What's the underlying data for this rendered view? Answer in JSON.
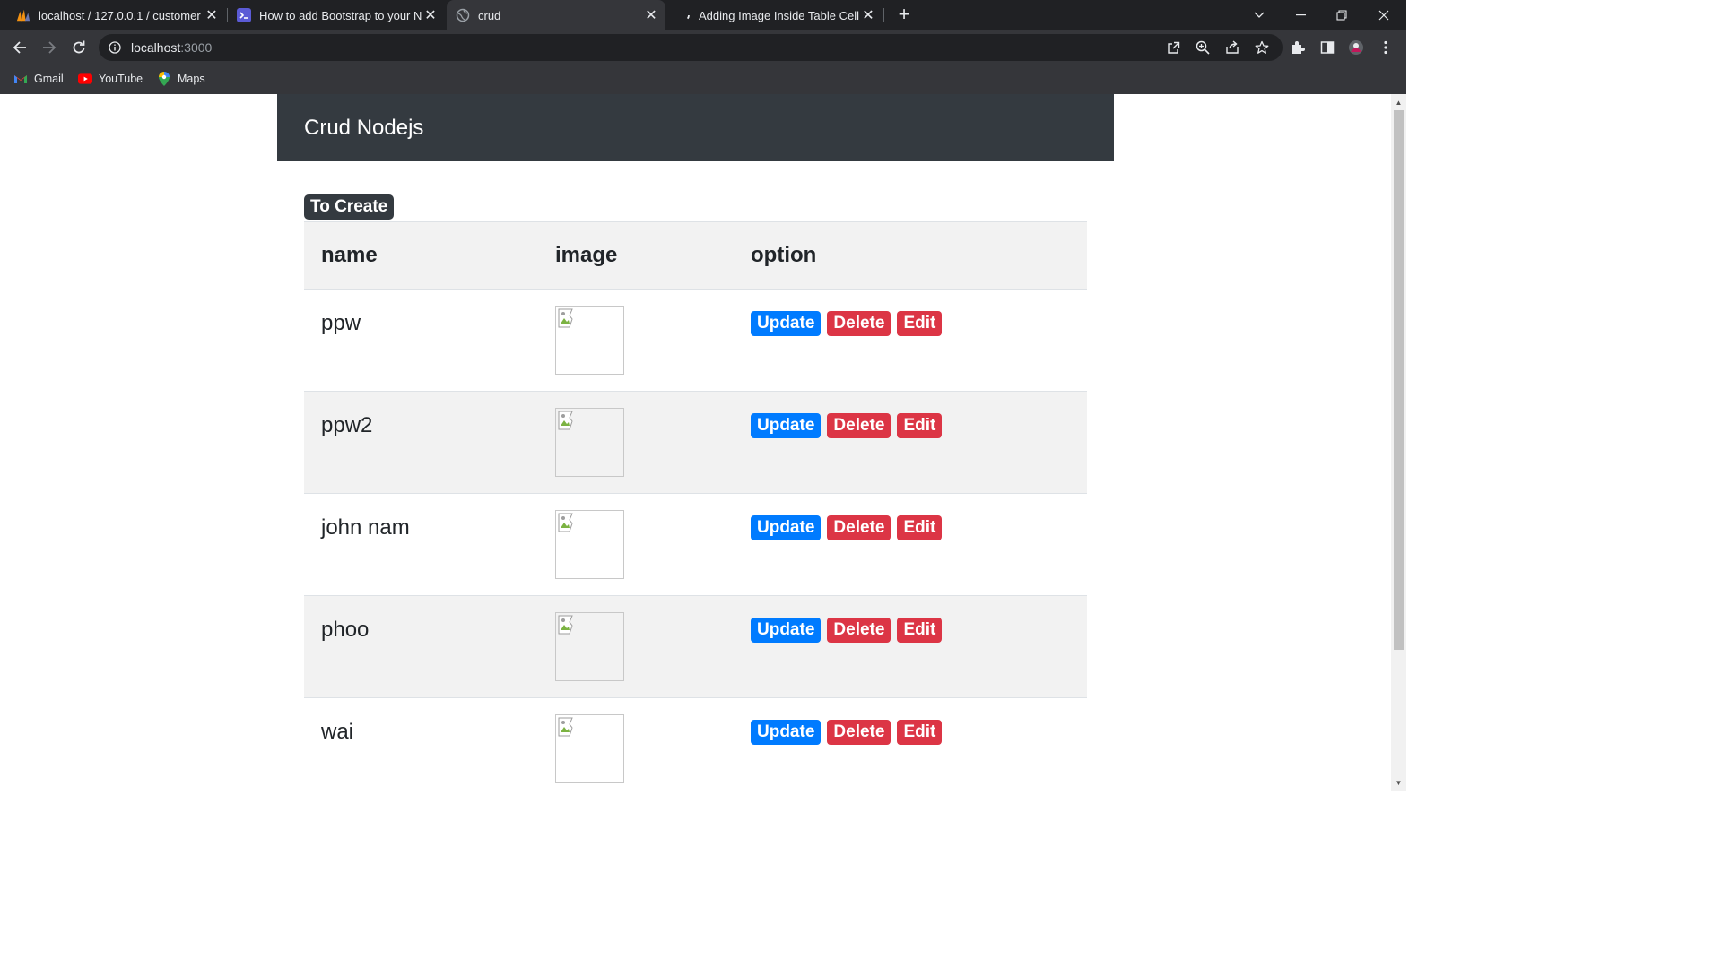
{
  "browser": {
    "tabs": [
      {
        "title": "localhost / 127.0.0.1 / customer /",
        "icon": "phpmyadmin-icon"
      },
      {
        "title": "How to add Bootstrap to your No",
        "icon": "terminal-icon"
      },
      {
        "title": "crud",
        "icon": "globe-icon",
        "active": true
      },
      {
        "title": "Adding Image Inside Table Cell in",
        "icon": "loading-icon"
      }
    ],
    "url_host": "localhost",
    "url_port": ":3000",
    "bookmarks": [
      {
        "label": "Gmail",
        "icon": "gmail-icon"
      },
      {
        "label": "YouTube",
        "icon": "youtube-icon"
      },
      {
        "label": "Maps",
        "icon": "maps-icon"
      }
    ]
  },
  "page": {
    "brand": "Crud Nodejs",
    "create_label": "To Create",
    "columns": {
      "name": "name",
      "image": "image",
      "option": "option"
    },
    "rows": [
      {
        "name": "ppw"
      },
      {
        "name": "ppw2"
      },
      {
        "name": "john nam"
      },
      {
        "name": "phoo"
      },
      {
        "name": "wai"
      }
    ],
    "actions": {
      "update": "Update",
      "delete": "Delete",
      "edit": "Edit"
    }
  },
  "colors": {
    "navbar": "#343a40",
    "update": "#007bff",
    "delete": "#dc3545",
    "edit": "#dc3545"
  }
}
